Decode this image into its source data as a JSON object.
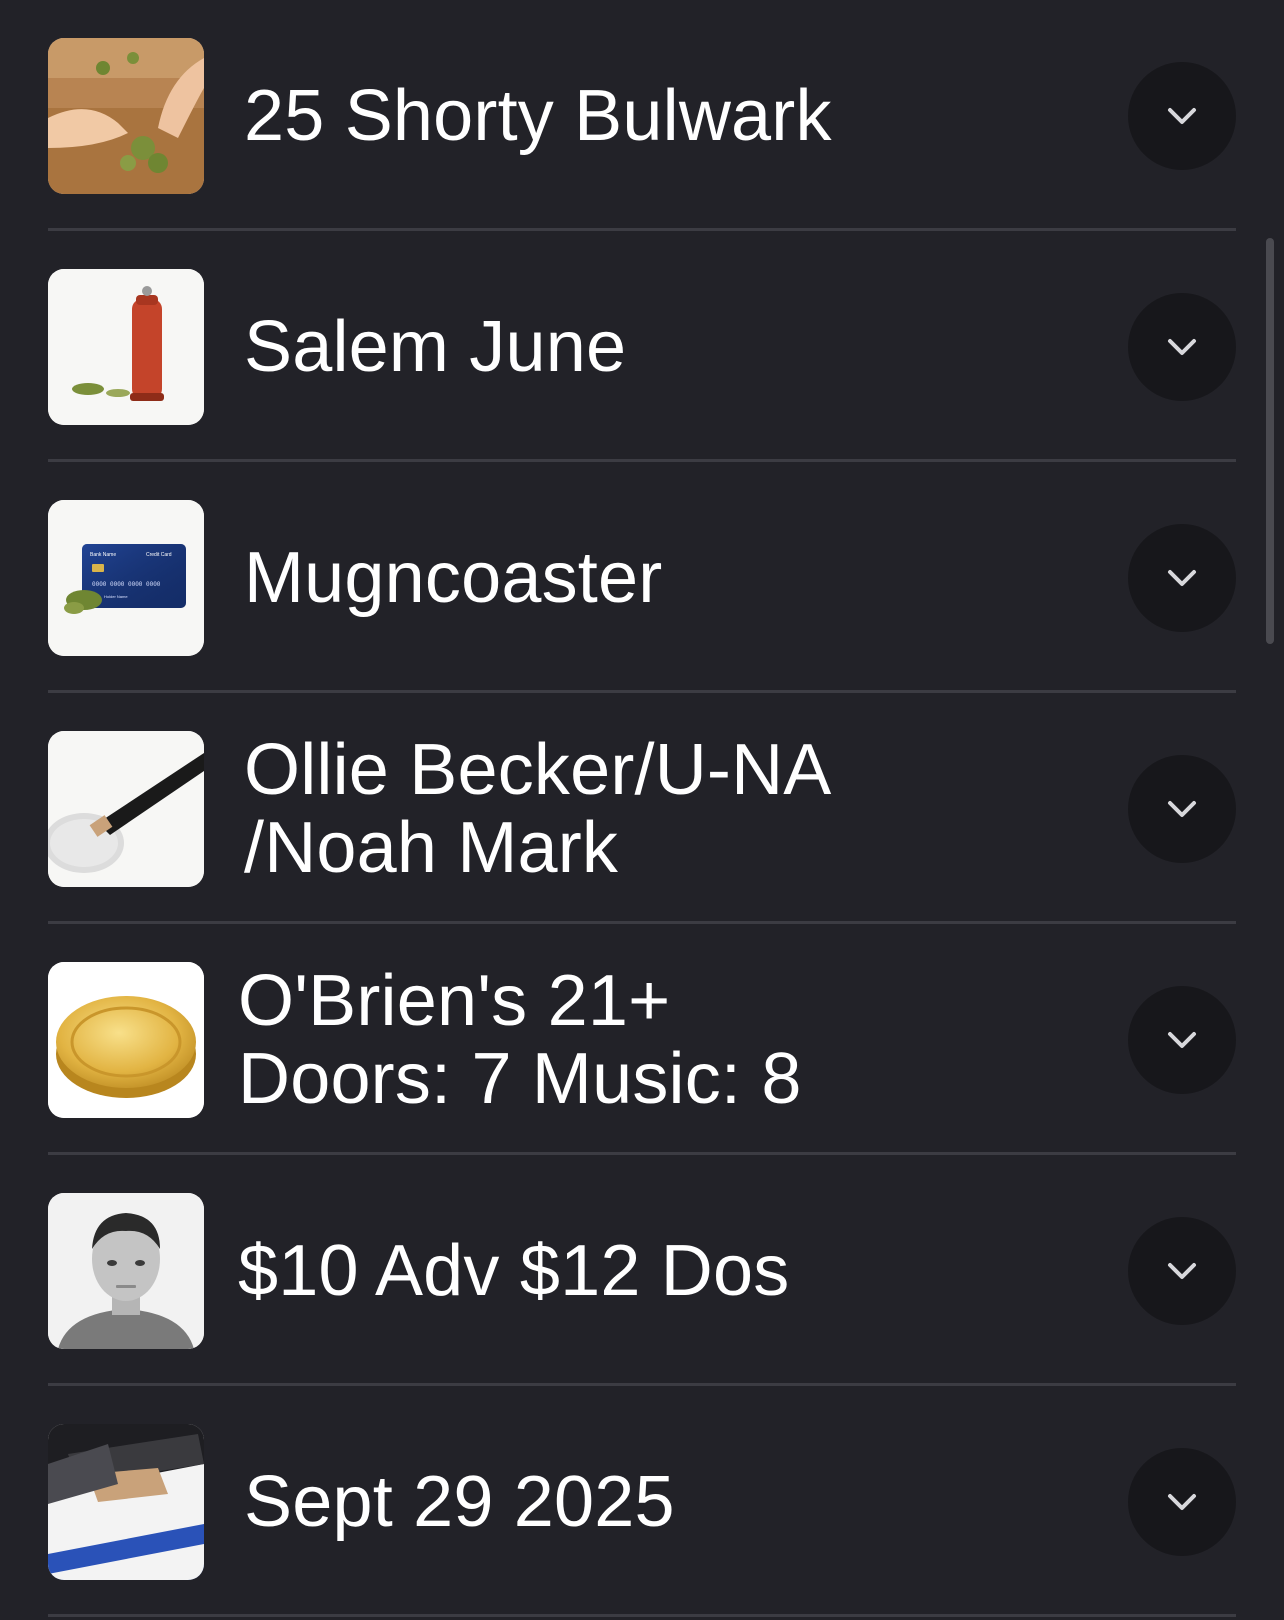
{
  "list": {
    "items": [
      {
        "label": "25 Shorty Bulwark",
        "image": "hands-sorting-herb-image"
      },
      {
        "label": "Salem June",
        "image": "pepper-grinder-image"
      },
      {
        "label": "Mugncoaster",
        "image": "credit-card-image",
        "card_bank": "Bank Name",
        "card_type": "Credit Card",
        "card_number": "0000 0000 0000 0000",
        "card_holder": "Holder Name"
      },
      {
        "label": "Ollie Becker/U-NA\n/Noah Mark",
        "image": "pizza-cutter-image"
      },
      {
        "label": "O'Brien's 21+\nDoors: 7 Music: 8",
        "image": "gold-coin-image"
      },
      {
        "label": "$10 Adv $12 Dos",
        "image": "portrait-photo-image"
      },
      {
        "label": "Sept 29 2025",
        "image": "laptop-box-image"
      }
    ],
    "expand_icon": "chevron-down-icon"
  },
  "colors": {
    "background": "#222228",
    "divider": "#3c3c43",
    "button_bg": "#17171b",
    "text": "#ffffff",
    "icon": "#d8d8dc"
  }
}
